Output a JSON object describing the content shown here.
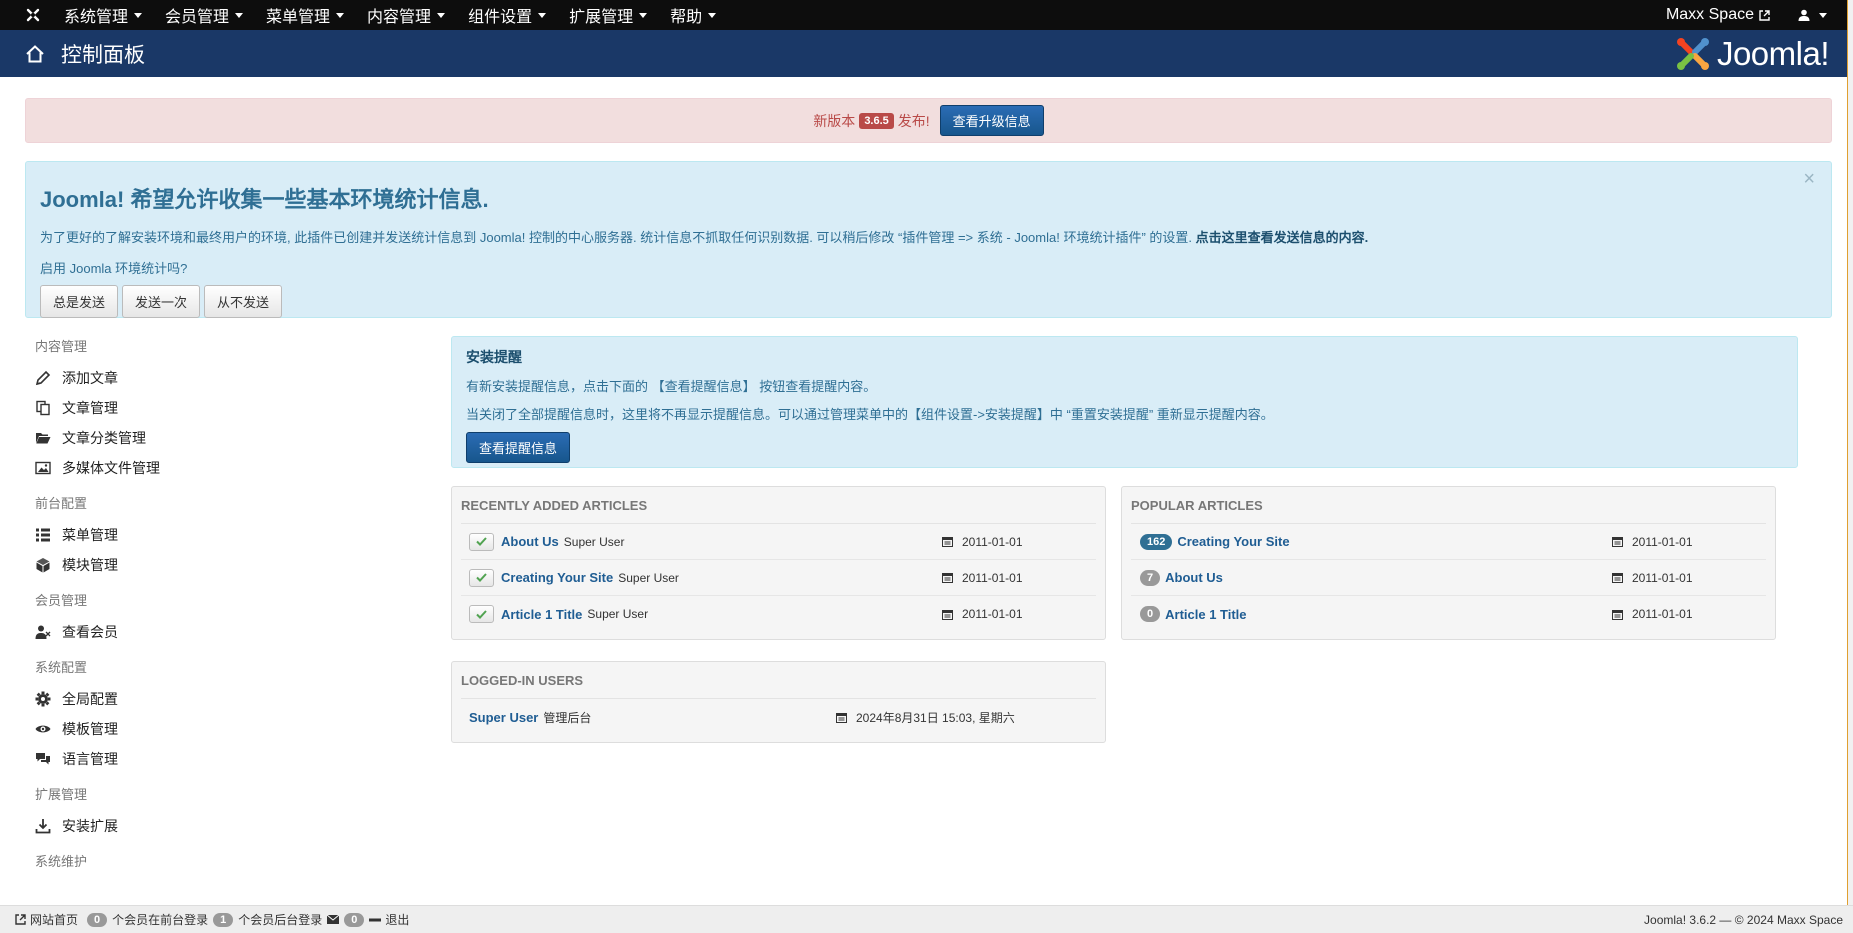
{
  "topnav": {
    "menu": [
      "系统管理",
      "会员管理",
      "菜单管理",
      "内容管理",
      "组件设置",
      "扩展管理",
      "帮助"
    ],
    "site_name": "Maxx Space"
  },
  "header": {
    "title": "控制面板",
    "brand": "Joomla!"
  },
  "update_alert": {
    "prefix": "新版本",
    "version": "3.6.5",
    "suffix": "发布!",
    "button": "查看升级信息"
  },
  "stats_alert": {
    "title": "Joomla! 希望允许收集一些基本环境统计信息.",
    "desc": "为了更好的了解安装环境和最终用户的环境, 此插件已创建并发送统计信息到 Joomla! 控制的中心服务器. 统计信息不抓取任何识别数据. 可以稍后修改 “插件管理 => 系统 - Joomla!  环境统计插件” 的设置. ",
    "desc_link": "点击这里查看发送信息的内容.",
    "question": "启用 Joomla 环境统计吗?",
    "buttons": [
      "总是发送",
      "发送一次",
      "从不发送"
    ],
    "close": "×"
  },
  "sidebar": {
    "groups": [
      {
        "heading": "内容管理",
        "items": [
          "添加文章",
          "文章管理",
          "文章分类管理",
          "多媒体文件管理"
        ]
      },
      {
        "heading": "前台配置",
        "items": [
          "菜单管理",
          "模块管理"
        ]
      },
      {
        "heading": "会员管理",
        "items": [
          "查看会员"
        ]
      },
      {
        "heading": "系统配置",
        "items": [
          "全局配置",
          "模板管理",
          "语言管理"
        ]
      },
      {
        "heading": "扩展管理",
        "items": [
          "安装扩展"
        ]
      },
      {
        "heading": "系统维护",
        "items": []
      }
    ]
  },
  "install_box": {
    "title": "安装提醒",
    "line1": "有新安装提醒信息，点击下面的 【查看提醒信息】 按钮查看提醒内容。",
    "line2": "当关闭了全部提醒信息时，这里将不再显示提醒信息。可以通过管理菜单中的【组件设置->安装提醒】中 “重置安装提醒” 重新显示提醒内容。",
    "button": "查看提醒信息"
  },
  "recent": {
    "title": "RECENTLY ADDED ARTICLES",
    "rows": [
      {
        "title": "About Us",
        "author": "Super User",
        "date": "2011-01-01"
      },
      {
        "title": "Creating Your Site",
        "author": "Super User",
        "date": "2011-01-01"
      },
      {
        "title": "Article 1 Title",
        "author": "Super User",
        "date": "2011-01-01"
      }
    ]
  },
  "popular": {
    "title": "POPULAR ARTICLES",
    "rows": [
      {
        "hits": "162",
        "title": "Creating Your Site",
        "date": "2011-01-01"
      },
      {
        "hits": "7",
        "title": "About Us",
        "date": "2011-01-01"
      },
      {
        "hits": "0",
        "title": "Article 1 Title",
        "date": "2011-01-01"
      }
    ]
  },
  "logged": {
    "title": "LOGGED-IN USERS",
    "rows": [
      {
        "user": "Super User",
        "location": "管理后台",
        "time": "2024年8月31日 15:03, 星期六"
      }
    ]
  },
  "footer": {
    "site_home": "网站首页",
    "frontend_count": "0",
    "frontend_label": "个会员在前台登录",
    "backend_count": "1",
    "backend_label": "个会员后台登录",
    "msg_count": "0",
    "logout": "退出",
    "version": "Joomla! 3.6.2  —  © 2024 Maxx Space"
  }
}
